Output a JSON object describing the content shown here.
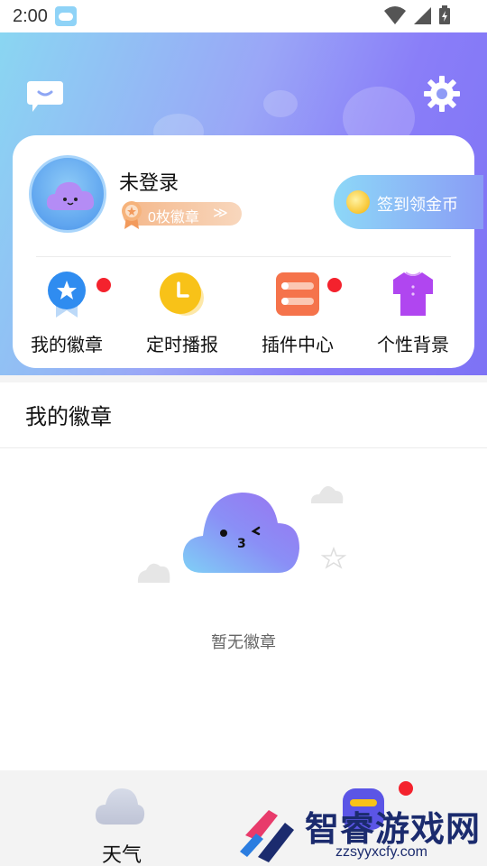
{
  "status_bar": {
    "time": "2:00"
  },
  "header": {
    "message_icon": "message-bubble-icon",
    "settings_icon": "gear-icon"
  },
  "profile": {
    "login_label": "未登录",
    "badge_count": "0枚徽章",
    "badge_chevron": "≫",
    "checkin_label": "签到领金币"
  },
  "menu": [
    {
      "label": "我的徽章",
      "icon": "badge-medal-icon",
      "has_dot": true
    },
    {
      "label": "定时播报",
      "icon": "clock-icon",
      "has_dot": false
    },
    {
      "label": "插件中心",
      "icon": "plugin-icon",
      "has_dot": true
    },
    {
      "label": "个性背景",
      "icon": "shirt-icon",
      "has_dot": false
    }
  ],
  "section": {
    "title": "我的徽章",
    "empty_text": "暂无徽章"
  },
  "bottom_nav": {
    "weather_label": "天气"
  },
  "watermark": {
    "text": "智睿游戏网",
    "url": "zzsyyxcfy.com"
  },
  "colors": {
    "header_gradient_start": "#8ad6f2",
    "header_gradient_end": "#7d72f5",
    "red_dot": "#f4222d",
    "badge_pill": "#f4b78a"
  }
}
